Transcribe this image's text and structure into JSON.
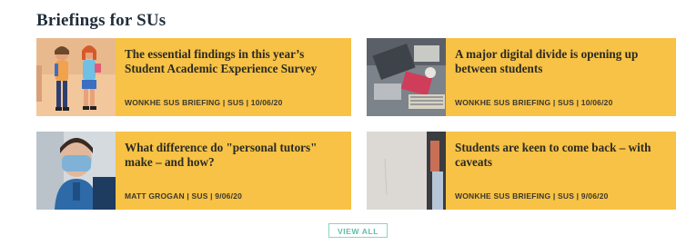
{
  "section": {
    "title": "Briefings for SUs"
  },
  "cards": [
    {
      "headline": "The essential findings in this year’s Student Academic Experience Survey",
      "meta": "WONKHE SUS BRIEFING | SUS | 10/06/20",
      "thumb_icon": "students-illustration-thumbnail"
    },
    {
      "headline": "A major digital divide is opening up between students",
      "meta": "WONKHE SUS BRIEFING | SUS | 10/06/20",
      "thumb_icon": "desk-laptop-thumbnail"
    },
    {
      "headline": "What difference do \"personal tutors\" make – and how?",
      "meta": "MATT GROGAN | SUS | 9/06/20",
      "thumb_icon": "masked-person-thumbnail"
    },
    {
      "headline": "Students are keen to come back – with caveats",
      "meta": "WONKHE SUS BRIEFING | SUS | 9/06/20",
      "thumb_icon": "wall-person-thumbnail"
    }
  ],
  "view_all": {
    "label": "VIEW ALL"
  },
  "colors": {
    "card_bg": "#f7c245",
    "accent": "#5fbda7",
    "title": "#1f2d3a"
  }
}
